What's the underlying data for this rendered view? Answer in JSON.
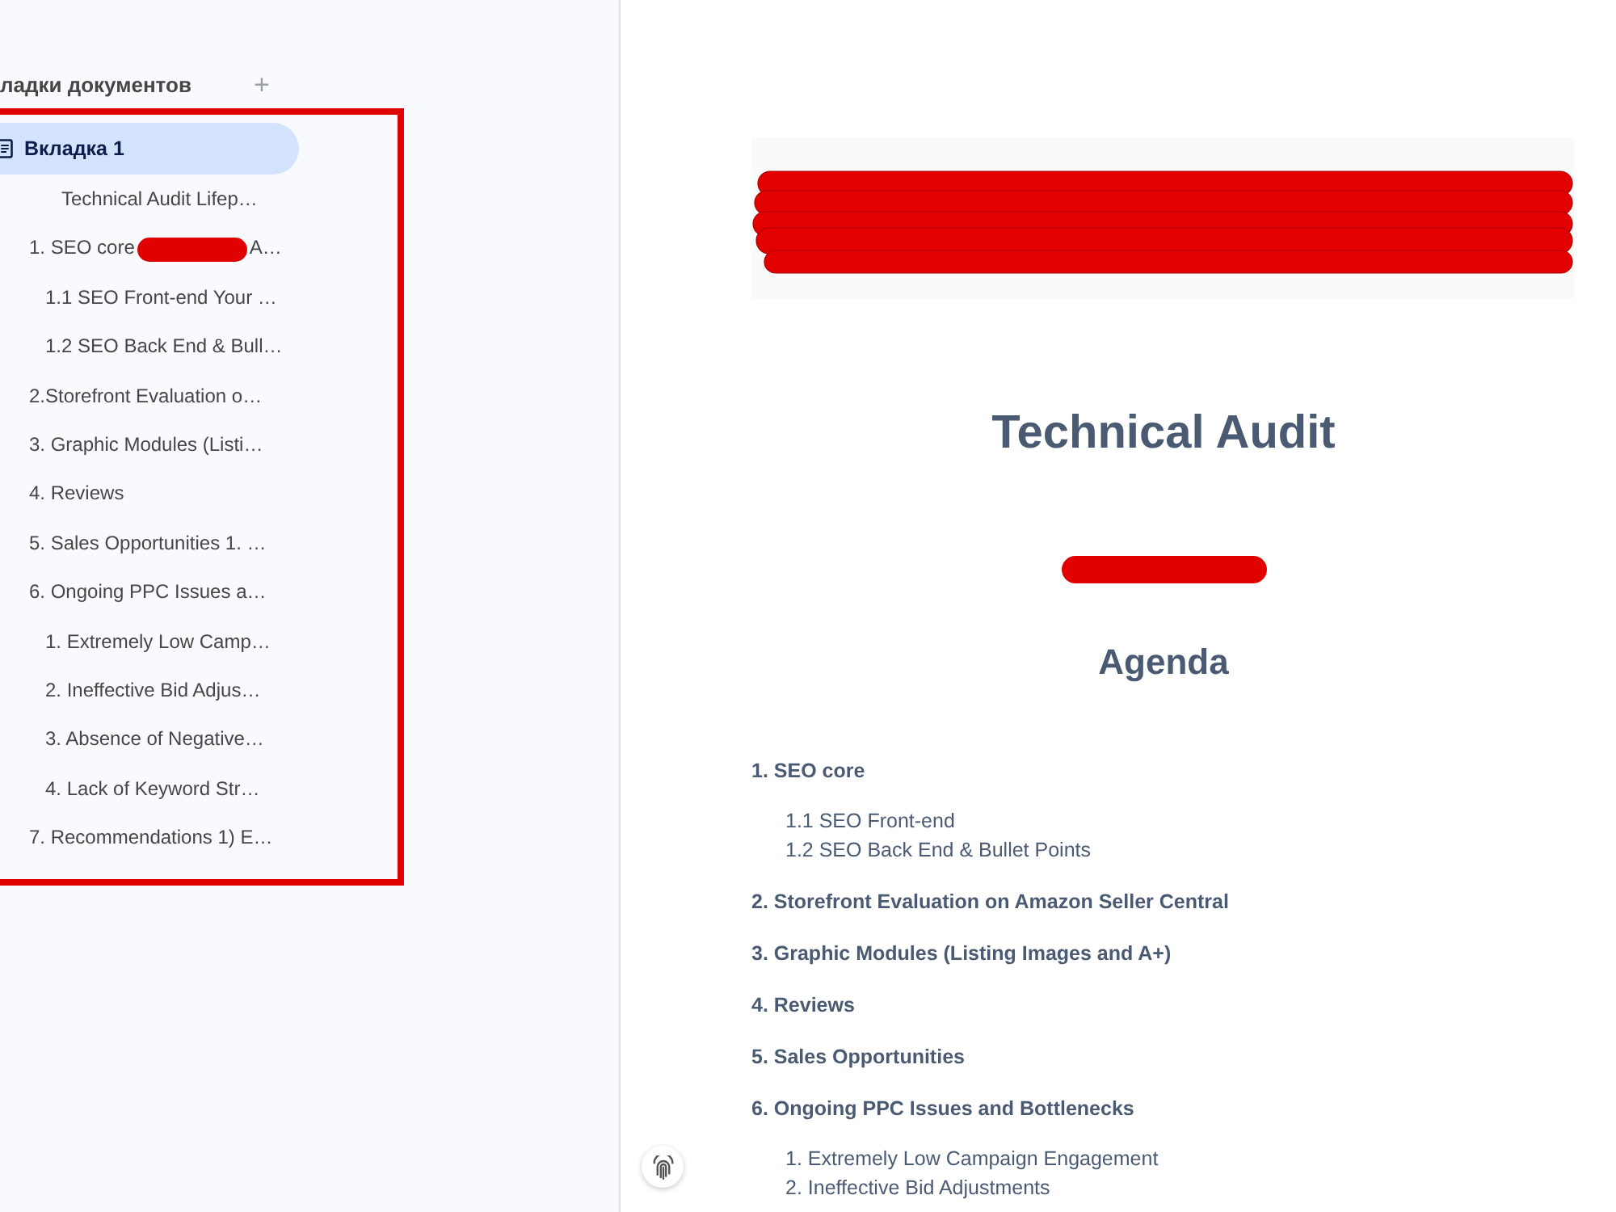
{
  "sidebar": {
    "title": "ладки документов",
    "add_button": "+",
    "tabs": [
      {
        "label": "Вкладка 1",
        "selected": true,
        "outline": [
          {
            "label": "Technical Audit Lifep…",
            "kind": "inset"
          },
          {
            "label": "1. SEO core",
            "continuation": "A…",
            "kind": "entry",
            "children": [
              {
                "label": "1.1 SEO Front-end Your …",
                "kind": "entry"
              },
              {
                "label": "1.2 SEO Back End & Bull…",
                "kind": "entry"
              }
            ]
          },
          {
            "label": "2.Storefront Evaluation o…",
            "kind": "entry"
          },
          {
            "label": "3. Graphic Modules (Listi…",
            "kind": "entry"
          },
          {
            "label": "4. Reviews",
            "kind": "entry"
          },
          {
            "label": "5. Sales Opportunities 1. …",
            "kind": "entry"
          },
          {
            "label": "6. Ongoing PPC Issues a…",
            "kind": "entry",
            "children": [
              {
                "label": "1. Extremely Low Camp…",
                "kind": "entry"
              },
              {
                "label": "2. Ineffective Bid Adjus…",
                "kind": "entry"
              },
              {
                "label": "3. Absence of Negative…",
                "kind": "entry"
              },
              {
                "label": "4. Lack of Keyword Str…",
                "kind": "entry"
              }
            ]
          },
          {
            "label": "7. Recommendations 1) E…",
            "kind": "entry"
          }
        ]
      }
    ]
  },
  "document": {
    "title": "Technical Audit",
    "agenda_heading": "Agenda",
    "agenda": [
      {
        "label": "1. SEO core",
        "children": [
          {
            "label": "1.1 SEO Front-end"
          },
          {
            "label": "1.2 SEO Back End & Bullet Points"
          }
        ]
      },
      {
        "label": "2. Storefront Evaluation on Amazon Seller Central"
      },
      {
        "label": "3. Graphic Modules (Listing Images and A+)"
      },
      {
        "label": "4. Reviews"
      },
      {
        "label": "5. Sales Opportunities"
      },
      {
        "label": "6. Ongoing PPC Issues and Bottlenecks",
        "children": [
          {
            "label": "1. Extremely Low Campaign Engagement"
          },
          {
            "label": "2. Ineffective Bid Adjustments"
          }
        ]
      }
    ]
  }
}
